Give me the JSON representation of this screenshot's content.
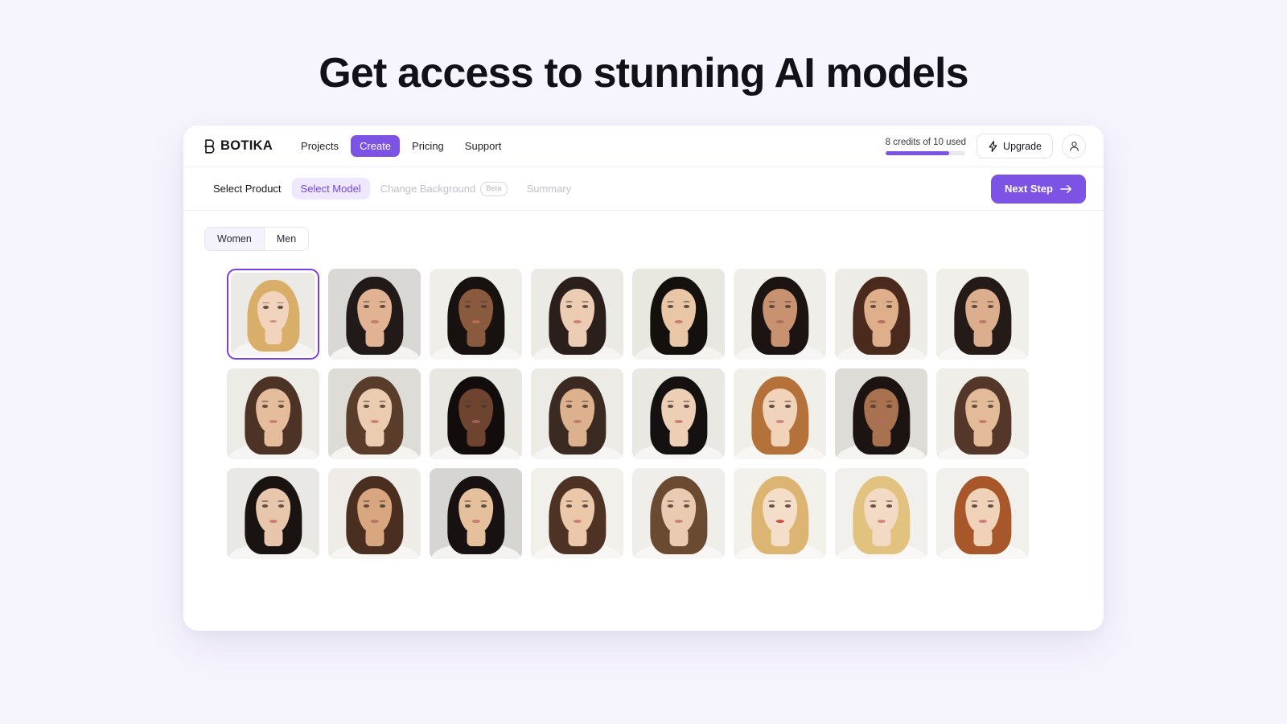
{
  "page": {
    "heading": "Get access to stunning AI models",
    "background_color": "#f6f4fd"
  },
  "navbar": {
    "brand": {
      "mark_icon": "botika-b-logomark",
      "name": "BOTIKA"
    },
    "links": [
      {
        "label": "Projects",
        "active": false
      },
      {
        "label": "Create",
        "active": true
      },
      {
        "label": "Pricing",
        "active": false
      },
      {
        "label": "Support",
        "active": false
      }
    ],
    "credits": {
      "label": "8 credits of 10 used",
      "used": 8,
      "total": 10,
      "percent": 80,
      "fill_color": "#7c53e4",
      "track_color": "#e9e6f2"
    },
    "upgrade": {
      "label": "Upgrade",
      "icon": "zap-icon"
    },
    "account": {
      "icon": "user-icon"
    }
  },
  "steps_bar": {
    "steps": [
      {
        "label": "Select Product",
        "state": "done",
        "badge": ""
      },
      {
        "label": "Select Model",
        "state": "active",
        "badge": ""
      },
      {
        "label": "Change Background",
        "state": "disabled",
        "badge": "Beta"
      },
      {
        "label": "Summary",
        "state": "disabled",
        "badge": ""
      }
    ],
    "next_button": {
      "label": "Next Step",
      "icon": "arrow-right-icon",
      "color": "#7c53e4"
    }
  },
  "filters": {
    "gender_toggle": {
      "options": [
        {
          "label": "Women",
          "selected": true
        },
        {
          "label": "Men",
          "selected": false
        }
      ]
    }
  },
  "model_grid": {
    "columns": 8,
    "selected_index": 0,
    "selection_color": "#7c3eea",
    "models": [
      {
        "name": "model-1",
        "selected": true,
        "bg": "#eceae6",
        "hair": "#d8ae68",
        "skin": "#f2d4bd",
        "lips": "#d98a80",
        "top": "#f6f5f3"
      },
      {
        "name": "model-2",
        "selected": false,
        "bg": "#d9d8d4",
        "hair": "#221a18",
        "skin": "#e2b393",
        "lips": "#c57b72",
        "top": "#f4f3f1"
      },
      {
        "name": "model-3",
        "selected": false,
        "bg": "#f0eee9",
        "hair": "#17110f",
        "skin": "#8a5a3e",
        "lips": "#b8695f",
        "top": "#f7f6f4"
      },
      {
        "name": "model-4",
        "selected": false,
        "bg": "#eceae5",
        "hair": "#2b1f1b",
        "skin": "#eccdb4",
        "lips": "#cf8076",
        "top": "#f6f5f3"
      },
      {
        "name": "model-5",
        "selected": false,
        "bg": "#e8e7e0",
        "hair": "#14100d",
        "skin": "#e8c6a6",
        "lips": "#c87a6f",
        "top": "#f4f3ef"
      },
      {
        "name": "model-6",
        "selected": false,
        "bg": "#f0eee9",
        "hair": "#1b1412",
        "skin": "#c89270",
        "lips": "#b06d63",
        "top": "#f7f6f4"
      },
      {
        "name": "model-7",
        "selected": false,
        "bg": "#eeece7",
        "hair": "#4a2a1d",
        "skin": "#dfae8a",
        "lips": "#bc7065",
        "top": "#f6f5f2"
      },
      {
        "name": "model-8",
        "selected": false,
        "bg": "#f1efea",
        "hair": "#241a17",
        "skin": "#dcae8d",
        "lips": "#c07a6f",
        "top": "#f7f6f4"
      },
      {
        "name": "model-9",
        "selected": false,
        "bg": "#edebe6",
        "hair": "#4d3326",
        "skin": "#e6bd9c",
        "lips": "#c67f74",
        "top": "#f6f5f3"
      },
      {
        "name": "model-10",
        "selected": false,
        "bg": "#dddcd6",
        "hair": "#5a3c2a",
        "skin": "#ecccb0",
        "lips": "#cb8379",
        "top": "#f5f4f1"
      },
      {
        "name": "model-11",
        "selected": false,
        "bg": "#e9e7e2",
        "hair": "#120d0c",
        "skin": "#6e4430",
        "lips": "#a65d56",
        "top": "#f6f5f3"
      },
      {
        "name": "model-12",
        "selected": false,
        "bg": "#edebe6",
        "hair": "#3b2a22",
        "skin": "#dcb18e",
        "lips": "#c17a6f",
        "top": "#f6f5f3"
      },
      {
        "name": "model-13",
        "selected": false,
        "bg": "#eae8e3",
        "hair": "#151111",
        "skin": "#eccfb4",
        "lips": "#cc7f75",
        "top": "#f6f5f3"
      },
      {
        "name": "model-14",
        "selected": false,
        "bg": "#f1efe9",
        "hair": "#b4723a",
        "skin": "#f0d3b8",
        "lips": "#cf8880",
        "top": "#f8f7f4"
      },
      {
        "name": "model-15",
        "selected": false,
        "bg": "#dedcd7",
        "hair": "#1c1412",
        "skin": "#a8714f",
        "lips": "#b56a62",
        "top": "#f5f4f1"
      },
      {
        "name": "model-16",
        "selected": false,
        "bg": "#f0eee9",
        "hair": "#55372a",
        "skin": "#e4bb99",
        "lips": "#c67d72",
        "top": "#f7f6f4"
      },
      {
        "name": "model-17",
        "selected": false,
        "bg": "#e9e8e5",
        "hair": "#191312",
        "skin": "#e8c6ab",
        "lips": "#cb7f76",
        "top": "#f6f5f3"
      },
      {
        "name": "model-18",
        "selected": false,
        "bg": "#efece7",
        "hair": "#4a2f20",
        "skin": "#d8a77f",
        "lips": "#bd7468",
        "top": "#f7f6f3"
      },
      {
        "name": "model-19",
        "selected": false,
        "bg": "#d6d5d1",
        "hair": "#171211",
        "skin": "#e4c09c",
        "lips": "#c27c70",
        "top": "#f4f3f1"
      },
      {
        "name": "model-20",
        "selected": false,
        "bg": "#f2f0eb",
        "hair": "#4e3324",
        "skin": "#ecc8ab",
        "lips": "#c97f74",
        "top": "#f8f7f5"
      },
      {
        "name": "model-21",
        "selected": false,
        "bg": "#efeeeb",
        "hair": "#6b4a32",
        "skin": "#eacbb2",
        "lips": "#c78279",
        "top": "#f8f7f5"
      },
      {
        "name": "model-22",
        "selected": false,
        "bg": "#f3f1ec",
        "hair": "#ddb572",
        "skin": "#f4ddc9",
        "lips": "#cf4f4f",
        "top": "#f9f8f6"
      },
      {
        "name": "model-23",
        "selected": false,
        "bg": "#f1f0ed",
        "hair": "#e2c27f",
        "skin": "#f3dac4",
        "lips": "#d2897f",
        "top": "#f9f8f6"
      },
      {
        "name": "model-24",
        "selected": false,
        "bg": "#f2f0ec",
        "hair": "#a8572a",
        "skin": "#f0d2b9",
        "lips": "#cf8076",
        "top": "#f9f8f6"
      }
    ]
  }
}
